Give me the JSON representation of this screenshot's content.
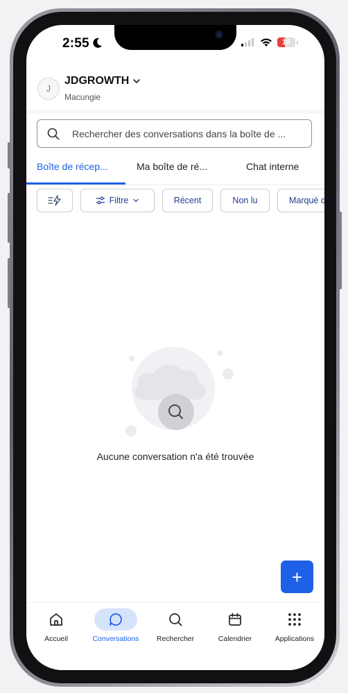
{
  "status_bar": {
    "time": "2:55",
    "battery": "16",
    "battery_color": "#e8413c"
  },
  "account": {
    "avatar_initial": "J",
    "name": "JDGROWTH",
    "location": "Macungie"
  },
  "search": {
    "placeholder": "Rechercher des conversations dans la boîte de ..."
  },
  "tabs": [
    {
      "label": "Boîte de récep...",
      "active": true
    },
    {
      "label": "Ma boîte de ré...",
      "active": false
    },
    {
      "label": "Chat interne",
      "active": false
    }
  ],
  "chips": {
    "quick_filter_icon": "lightning-sort-icon",
    "filter_label": "Filtre",
    "recent_label": "Récent",
    "unread_label": "Non lu",
    "starred_label": "Marqué d"
  },
  "empty_state": {
    "message": "Aucune conversation n'a été trouvée"
  },
  "fab": {
    "label": "+"
  },
  "bottom_nav": [
    {
      "label": "Accueil",
      "icon": "home-icon",
      "active": false
    },
    {
      "label": "Conversations",
      "icon": "chat-bubble-icon",
      "active": true
    },
    {
      "label": "Rechercher",
      "icon": "search-icon",
      "active": false
    },
    {
      "label": "Calendrier",
      "icon": "calendar-icon",
      "active": false
    },
    {
      "label": "Applications",
      "icon": "apps-grid-icon",
      "active": false
    }
  ],
  "colors": {
    "accent": "#1e60e6",
    "active_nav_bg": "#d6e4fb"
  }
}
